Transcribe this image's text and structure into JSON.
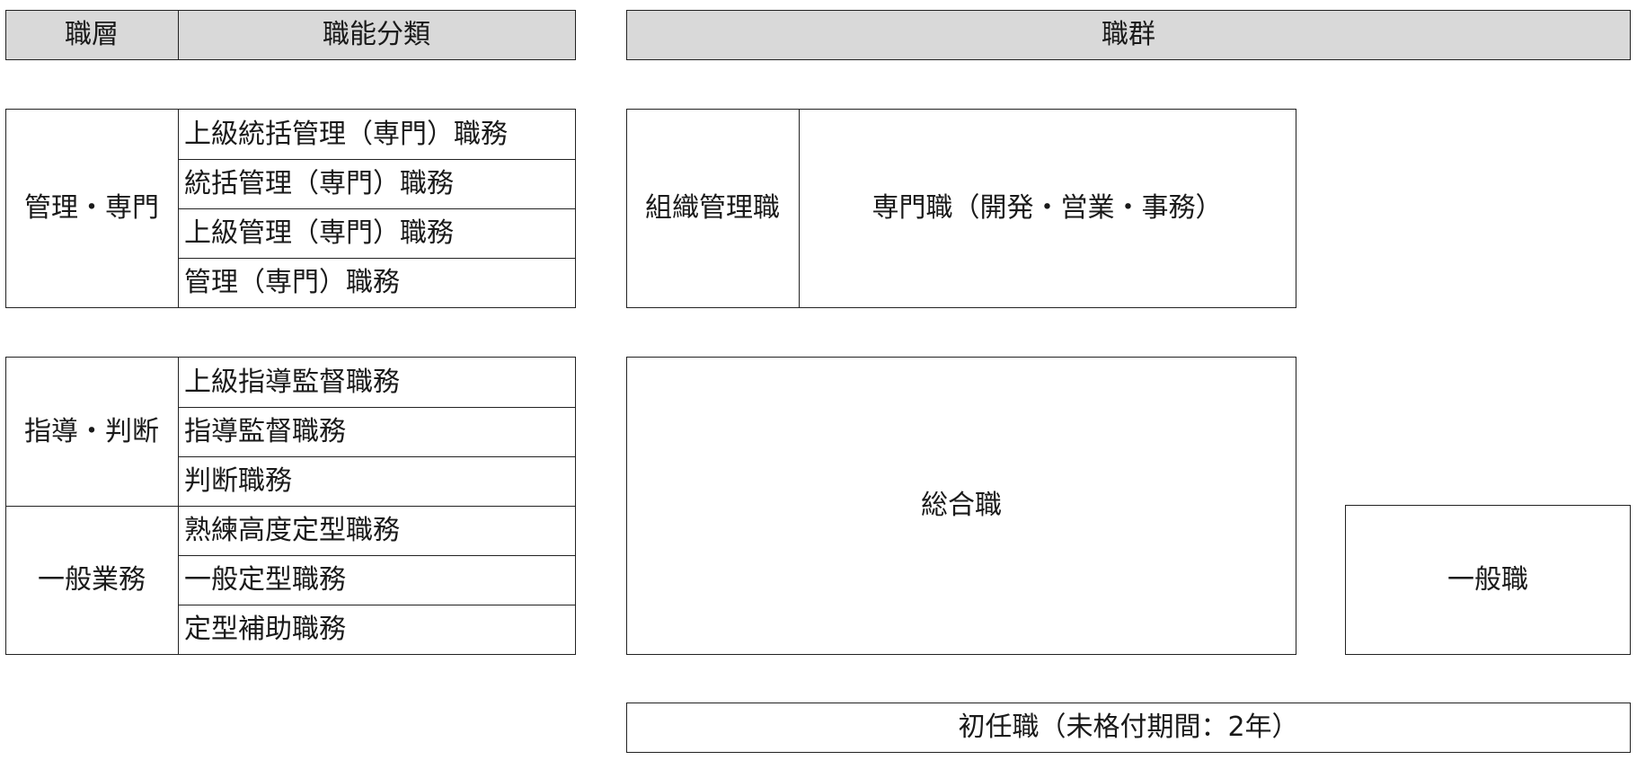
{
  "headers": {
    "tier": "職層",
    "function_class": "職能分類",
    "job_group": "職群"
  },
  "tiers": {
    "management": {
      "label": "管理・専門",
      "duties": [
        "上級統括管理（専門）職務",
        "統括管理（専門）職務",
        "上級管理（専門）職務",
        "管理（専門）職務"
      ]
    },
    "guidance": {
      "label": "指導・判断",
      "duties": [
        "上級指導監督職務",
        "指導監督職務",
        "判断職務"
      ]
    },
    "general": {
      "label": "一般業務",
      "duties": [
        "熟練高度定型職務",
        "一般定型職務",
        "定型補助職務"
      ]
    }
  },
  "job_groups": {
    "org_management": "組織管理職",
    "specialist": "専門職（開発・営業・事務）",
    "career_track": "総合職",
    "general_staff": "一般職",
    "entry_level": "初任職（未格付期間：2年）"
  },
  "colors": {
    "header_fill": "#d9d9d9",
    "border": "#222222",
    "background": "#ffffff"
  }
}
